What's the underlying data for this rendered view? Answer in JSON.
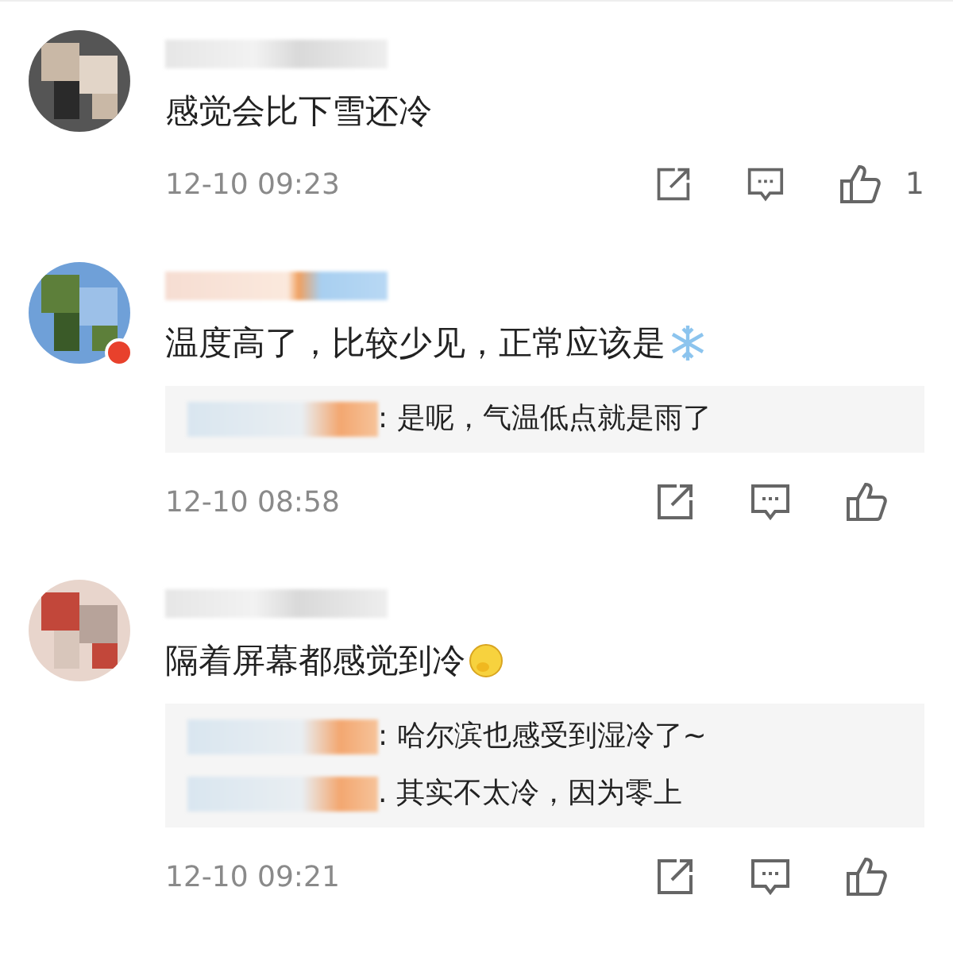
{
  "comments": [
    {
      "avatar_badge": false,
      "text": "感觉会比下雪还冷",
      "time": "12-10 09:23",
      "like_count": "1"
    },
    {
      "avatar_badge": true,
      "text": "温度高了，比较少见，正常应该是",
      "emoji": {
        "kind": "snowflake"
      },
      "replies": [
        {
          "text": ": 是呢，气温低点就是雨了"
        }
      ],
      "time": "12-10 08:58"
    },
    {
      "avatar_badge": false,
      "text": "隔着屏幕都感觉到冷",
      "emoji": {
        "kind": "shiver"
      },
      "replies": [
        {
          "text": ": 哈尔滨也感受到湿冷了~"
        },
        {
          "text": ". 其实不太冷，因为零上"
        }
      ],
      "time": "12-10 09:21"
    }
  ]
}
